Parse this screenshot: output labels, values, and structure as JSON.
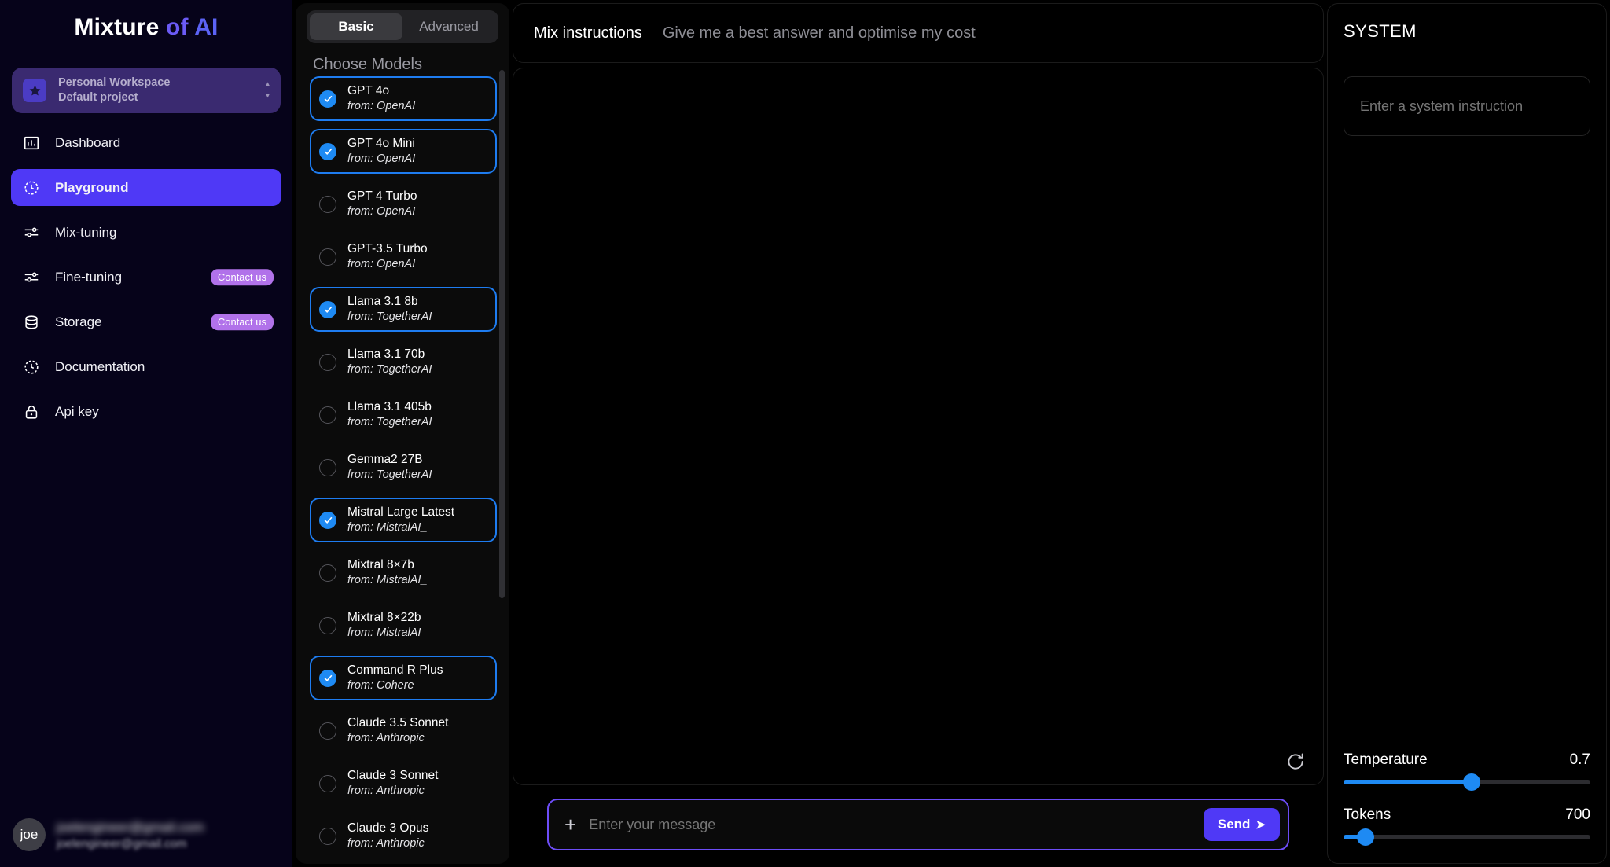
{
  "brand": {
    "part1": "Mixture",
    "part2": " of ",
    "part3": "AI"
  },
  "sidebar": {
    "workspace": {
      "line1": "Personal Workspace",
      "line2": "Default project",
      "icon": "star-icon"
    },
    "items": [
      {
        "label": "Dashboard",
        "icon": "chart-bars-icon",
        "active": false,
        "badge": null
      },
      {
        "label": "Playground",
        "icon": "clock-dashed-icon",
        "active": true,
        "badge": null
      },
      {
        "label": "Mix-tuning",
        "icon": "sliders-icon",
        "active": false,
        "badge": null
      },
      {
        "label": "Fine-tuning",
        "icon": "sliders-icon",
        "active": false,
        "badge": "Contact us"
      },
      {
        "label": "Storage",
        "icon": "database-icon",
        "active": false,
        "badge": "Contact us"
      },
      {
        "label": "Documentation",
        "icon": "clock-dashed-icon",
        "active": false,
        "badge": null
      },
      {
        "label": "Api key",
        "icon": "lock-icon",
        "active": false,
        "badge": null
      }
    ],
    "user": {
      "avatar_initials": "joe",
      "name": "joelengineer@gmail.com",
      "email": "joelengineer@gmail.com"
    }
  },
  "models_panel": {
    "tabs": [
      {
        "label": "Basic",
        "active": true
      },
      {
        "label": "Advanced",
        "active": false
      }
    ],
    "section_title": "Choose Models",
    "models": [
      {
        "name": "GPT 4o",
        "from": "from: OpenAI",
        "selected": true
      },
      {
        "name": "GPT 4o Mini",
        "from": "from: OpenAI",
        "selected": true
      },
      {
        "name": "GPT 4 Turbo",
        "from": "from: OpenAI",
        "selected": false
      },
      {
        "name": "GPT-3.5 Turbo",
        "from": "from: OpenAI",
        "selected": false
      },
      {
        "name": "Llama 3.1 8b",
        "from": "from: TogetherAI",
        "selected": true
      },
      {
        "name": "Llama 3.1 70b",
        "from": "from: TogetherAI",
        "selected": false
      },
      {
        "name": "Llama 3.1 405b",
        "from": "from: TogetherAI",
        "selected": false
      },
      {
        "name": "Gemma2 27B",
        "from": "from: TogetherAI",
        "selected": false
      },
      {
        "name": "Mistral Large Latest",
        "from": "from: MistralAI_",
        "selected": true
      },
      {
        "name": "Mixtral 8×7b",
        "from": "from: MistralAI_",
        "selected": false
      },
      {
        "name": "Mixtral 8×22b",
        "from": "from: MistralAI_",
        "selected": false
      },
      {
        "name": "Command R Plus",
        "from": "from: Cohere",
        "selected": true
      },
      {
        "name": "Claude 3.5 Sonnet",
        "from": "from: Anthropic",
        "selected": false
      },
      {
        "name": "Claude 3 Sonnet",
        "from": "from: Anthropic",
        "selected": false
      },
      {
        "name": "Claude 3 Opus",
        "from": "from: Anthropic",
        "selected": false
      }
    ]
  },
  "center": {
    "mix_instructions_label": "Mix instructions",
    "mix_instructions_value": "Give me a best answer and optimise my cost",
    "refresh_icon": "refresh-icon",
    "composer": {
      "plus_icon": "plus-icon",
      "placeholder": "Enter your message",
      "value": "",
      "send_label": "Send",
      "send_icon": "send-arrow-icon"
    }
  },
  "right_panel": {
    "system_title": "SYSTEM",
    "system_placeholder": "Enter a system instruction",
    "system_value": "",
    "sliders": [
      {
        "label": "Temperature",
        "value": "0.7",
        "percent": 52
      },
      {
        "label": "Tokens",
        "value": "700",
        "percent": 9
      }
    ]
  },
  "colors": {
    "accent_purple": "#4f39f6",
    "accent_blue": "#1e8af3",
    "badge_purple": "#b172ea",
    "sidebar_bg": "#06031a",
    "panel_bg": "#0b0b0b"
  }
}
